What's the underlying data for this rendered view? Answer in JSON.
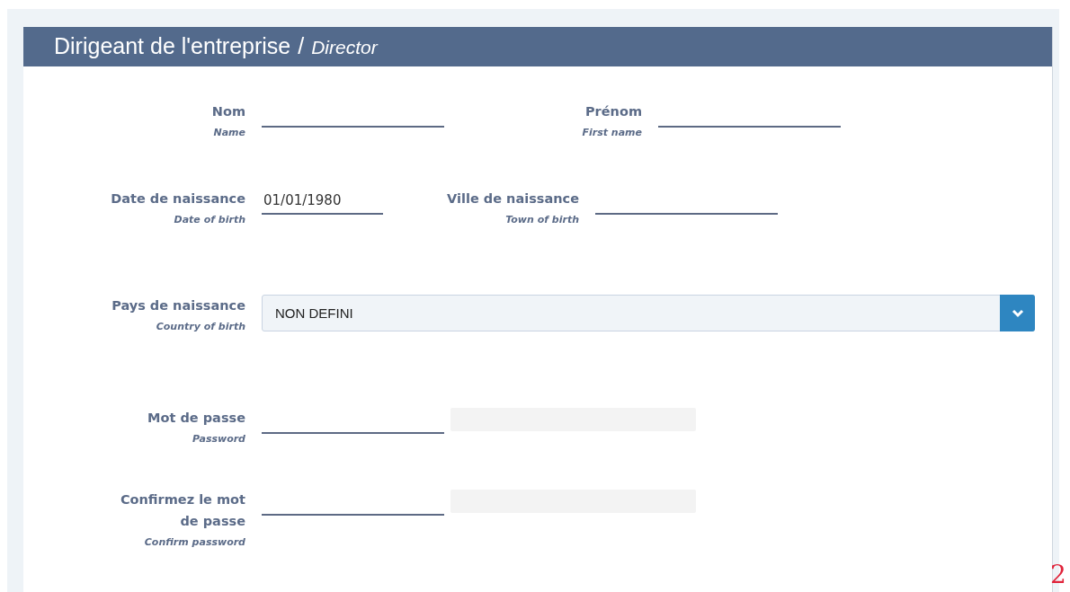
{
  "panel": {
    "title": "Dirigeant de l'entreprise",
    "separator": "/",
    "subtitle": "Director"
  },
  "rows": [
    {
      "fields": [
        {
          "kind": "text",
          "label": "Nom",
          "sublabel": "Name"
        },
        {
          "kind": "text",
          "label": "Prénom",
          "sublabel": "First name"
        }
      ]
    },
    {
      "fields": [
        {
          "kind": "date",
          "label": "Date de naissance",
          "sublabel": "Date of birth",
          "value": "01/01/1980"
        },
        {
          "kind": "text",
          "label": "Ville de naissance",
          "sublabel": "Town of birth"
        }
      ]
    },
    {
      "fields": [
        {
          "kind": "select",
          "label": "Pays de naissance",
          "sublabel": "Country of birth",
          "value": "NON DEFINI"
        }
      ]
    },
    {
      "fields": [
        {
          "kind": "password",
          "label": "Mot de passe",
          "sublabel": "Password"
        }
      ]
    },
    {
      "fields": [
        {
          "kind": "password",
          "label": "Confirmez le mot de passe",
          "sublabel": "Confirm password"
        }
      ]
    }
  ],
  "corner_mark": "2"
}
